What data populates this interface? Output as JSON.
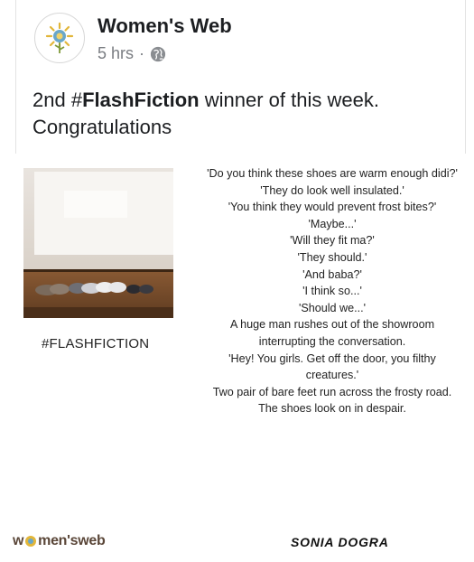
{
  "post": {
    "page_name": "Women's Web",
    "time": "5 hrs",
    "separator": "·",
    "text_prefix": "2nd #",
    "text_bold": "FlashFiction",
    "text_suffix": " winner of this week.",
    "text_line2": "Congratulations"
  },
  "image": {
    "hashtag": "#FLASHFICTION",
    "story_lines": [
      "'Do you think these shoes are warm enough didi?'",
      "'They do look well insulated.'",
      "'You think they would prevent frost bites?'",
      "'Maybe...'",
      "'Will they fit ma?'",
      "'They should.'",
      "'And baba?'",
      "'I think so...'",
      "'Should we...'",
      "A huge man rushes out of the showroom",
      "interrupting the conversation.",
      "'Hey! You girls. Get off the door, you filthy",
      "creatures.'",
      "Two pair of bare feet run across the frosty road.",
      "The shoes look on in despair."
    ],
    "brand_part1": "w",
    "brand_part2": "men's",
    "brand_part3": "web",
    "author": "SONIA DOGRA"
  },
  "icons": {
    "avatar": "sunflower-logo-icon",
    "audience": "globe-icon"
  },
  "colors": {
    "accent": "#7f9a3a",
    "brand": "#5a4638",
    "meta": "#7a7d82"
  }
}
